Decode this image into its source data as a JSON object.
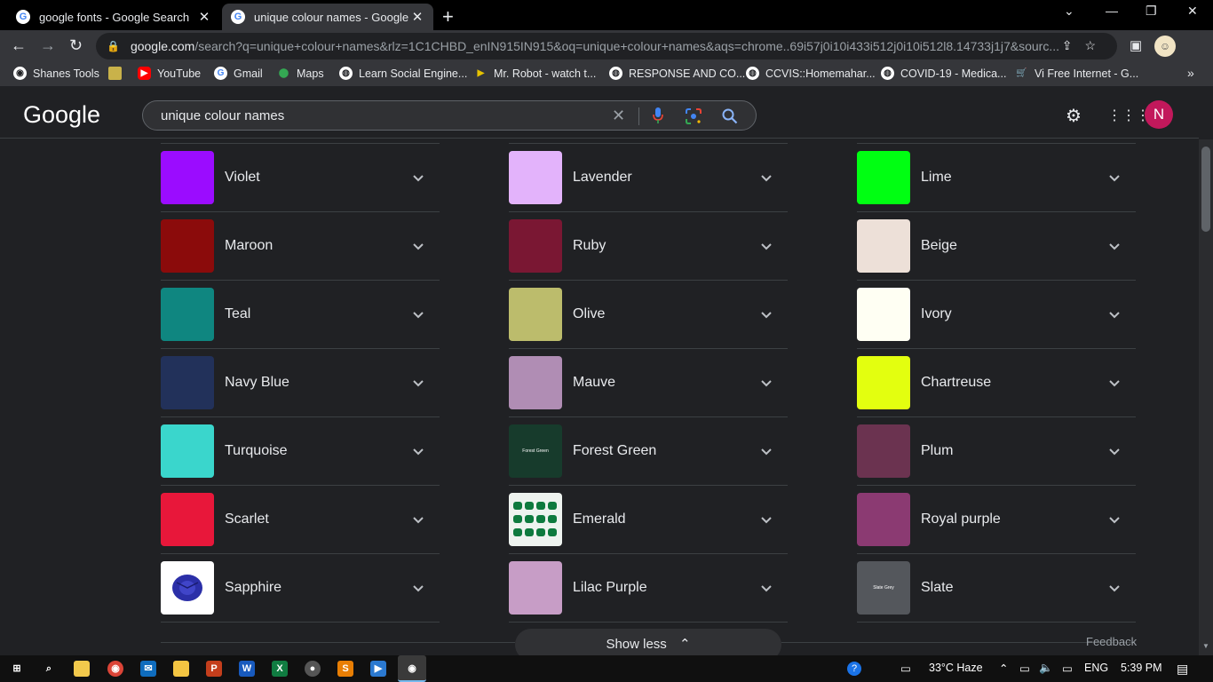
{
  "tabs": [
    {
      "title": "google fonts - Google Search",
      "icon": "google-favicon"
    },
    {
      "title": "unique colour names - Google Se",
      "icon": "google-favicon"
    }
  ],
  "address": {
    "host": "google.com",
    "path": "/search?q=unique+colour+names&rlz=1C1CHBD_enIN915IN915&oq=unique+colour+names&aqs=chrome..69i57j0i10i433i512j0i10i512l8.14733j1j7&sourc..."
  },
  "bookmarks": [
    {
      "label": "Shanes Tools",
      "icon": "chrome-icon"
    },
    {
      "label": "",
      "icon": "image-bookmark-icon"
    },
    {
      "label": "YouTube",
      "icon": "youtube-icon"
    },
    {
      "label": "Gmail",
      "icon": "google-icon"
    },
    {
      "label": "Maps",
      "icon": "maps-icon"
    },
    {
      "label": "Learn Social Engine...",
      "icon": "globe-icon"
    },
    {
      "label": "Mr. Robot - watch t...",
      "icon": "play-icon"
    },
    {
      "label": "RESPONSE AND CO...",
      "icon": "globe-icon"
    },
    {
      "label": "CCVIS::Homemahar...",
      "icon": "globe-icon"
    },
    {
      "label": "COVID-19 - Medica...",
      "icon": "globe-icon"
    },
    {
      "label": "Vi Free Internet - G...",
      "icon": "cart-icon"
    }
  ],
  "google": {
    "logo": "Google",
    "query": "unique colour names",
    "avatar_letter": "N"
  },
  "colors": {
    "col1": [
      {
        "name": "Violet",
        "swatch": "#9b0cff"
      },
      {
        "name": "Maroon",
        "swatch": "#8b0b0b"
      },
      {
        "name": "Teal",
        "swatch": "#0f8680"
      },
      {
        "name": "Navy Blue",
        "swatch": "#22315a"
      },
      {
        "name": "Turquoise",
        "swatch": "#3ad6cc"
      },
      {
        "name": "Scarlet",
        "swatch": "#e8173a"
      },
      {
        "name": "Sapphire",
        "swatch": "#ffffff"
      }
    ],
    "col2": [
      {
        "name": "Lavender",
        "swatch": "#e3b3fb"
      },
      {
        "name": "Ruby",
        "swatch": "#7a1733"
      },
      {
        "name": "Olive",
        "swatch": "#bcbc6c"
      },
      {
        "name": "Mauve",
        "swatch": "#b08db4"
      },
      {
        "name": "Forest Green",
        "swatch": "#173b2c",
        "inner_text": "Forest Green"
      },
      {
        "name": "Emerald",
        "swatch": "#eef3ef"
      },
      {
        "name": "Lilac Purple",
        "swatch": "#c79dc6"
      }
    ],
    "col3": [
      {
        "name": "Lime",
        "swatch": "#00ff12"
      },
      {
        "name": "Beige",
        "swatch": "#ede0d8"
      },
      {
        "name": "Ivory",
        "swatch": "#fffff3"
      },
      {
        "name": "Chartreuse",
        "swatch": "#e3ff0f"
      },
      {
        "name": "Plum",
        "swatch": "#6b3350"
      },
      {
        "name": "Royal purple",
        "swatch": "#8b3a72"
      },
      {
        "name": "Slate",
        "swatch": "#54575c",
        "inner_text": "Slate Grey"
      }
    ]
  },
  "show_less_label": "Show less",
  "feedback_label": "Feedback",
  "tray": {
    "weather": "33°C  Haze",
    "lang": "ENG",
    "time": "5:39 PM"
  }
}
